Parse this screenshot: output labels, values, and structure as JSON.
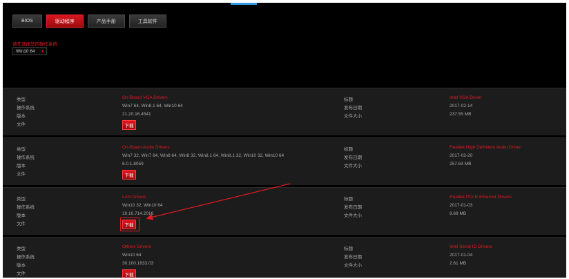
{
  "tabs": [
    {
      "label": "BIOS",
      "active": false
    },
    {
      "label": "驱动程序",
      "active": true
    },
    {
      "label": "产品手册",
      "active": false
    },
    {
      "label": "工具软件",
      "active": false
    }
  ],
  "os_selector": {
    "label": "请先选择您的操作系统",
    "value": "Win10 64"
  },
  "field_labels": {
    "type": "类型",
    "os": "操作系统",
    "version": "版本",
    "file": "文件",
    "title": "标题",
    "release_date": "发布日期",
    "file_size": "文件大小"
  },
  "download_label": "下载",
  "drivers": [
    {
      "type": "On-Board VGA Drivers",
      "os": "Win7 64, Win8.1 64, Win10 64",
      "version": "21.20.16.4541",
      "title": "Intel VGA Driver",
      "date": "2017-02-14",
      "size": "237.55 MB"
    },
    {
      "type": "On-Board Audio Drivers",
      "os": "Win7 32, Win7 64, Win8 64, Win8 32, Win8.1 64, Win8.1 32, Win10 32, Win10 64",
      "version": "6.0.1.8059",
      "title": "Realtek High Definition Audio Driver",
      "date": "2017-02-20",
      "size": "257.63 MB"
    },
    {
      "type": "LAN Drivers",
      "os": "Win10 32, Win10 64",
      "version": "10.10.714.2016",
      "title": "Realtek PCI-E Ethernet Drivers",
      "date": "2017-01-03",
      "size": "9.69 MB"
    },
    {
      "type": "Others Drivers",
      "os": "Win10 64",
      "version": "30.100.1633.03",
      "title": "Intel Serial IO Drivers",
      "date": "2017-01-04",
      "size": "2.61 MB"
    }
  ],
  "colors": {
    "accent": "#e11b22",
    "background": "#000000",
    "row_background": "#1c1c1c",
    "indicator": "#2f9be6"
  }
}
